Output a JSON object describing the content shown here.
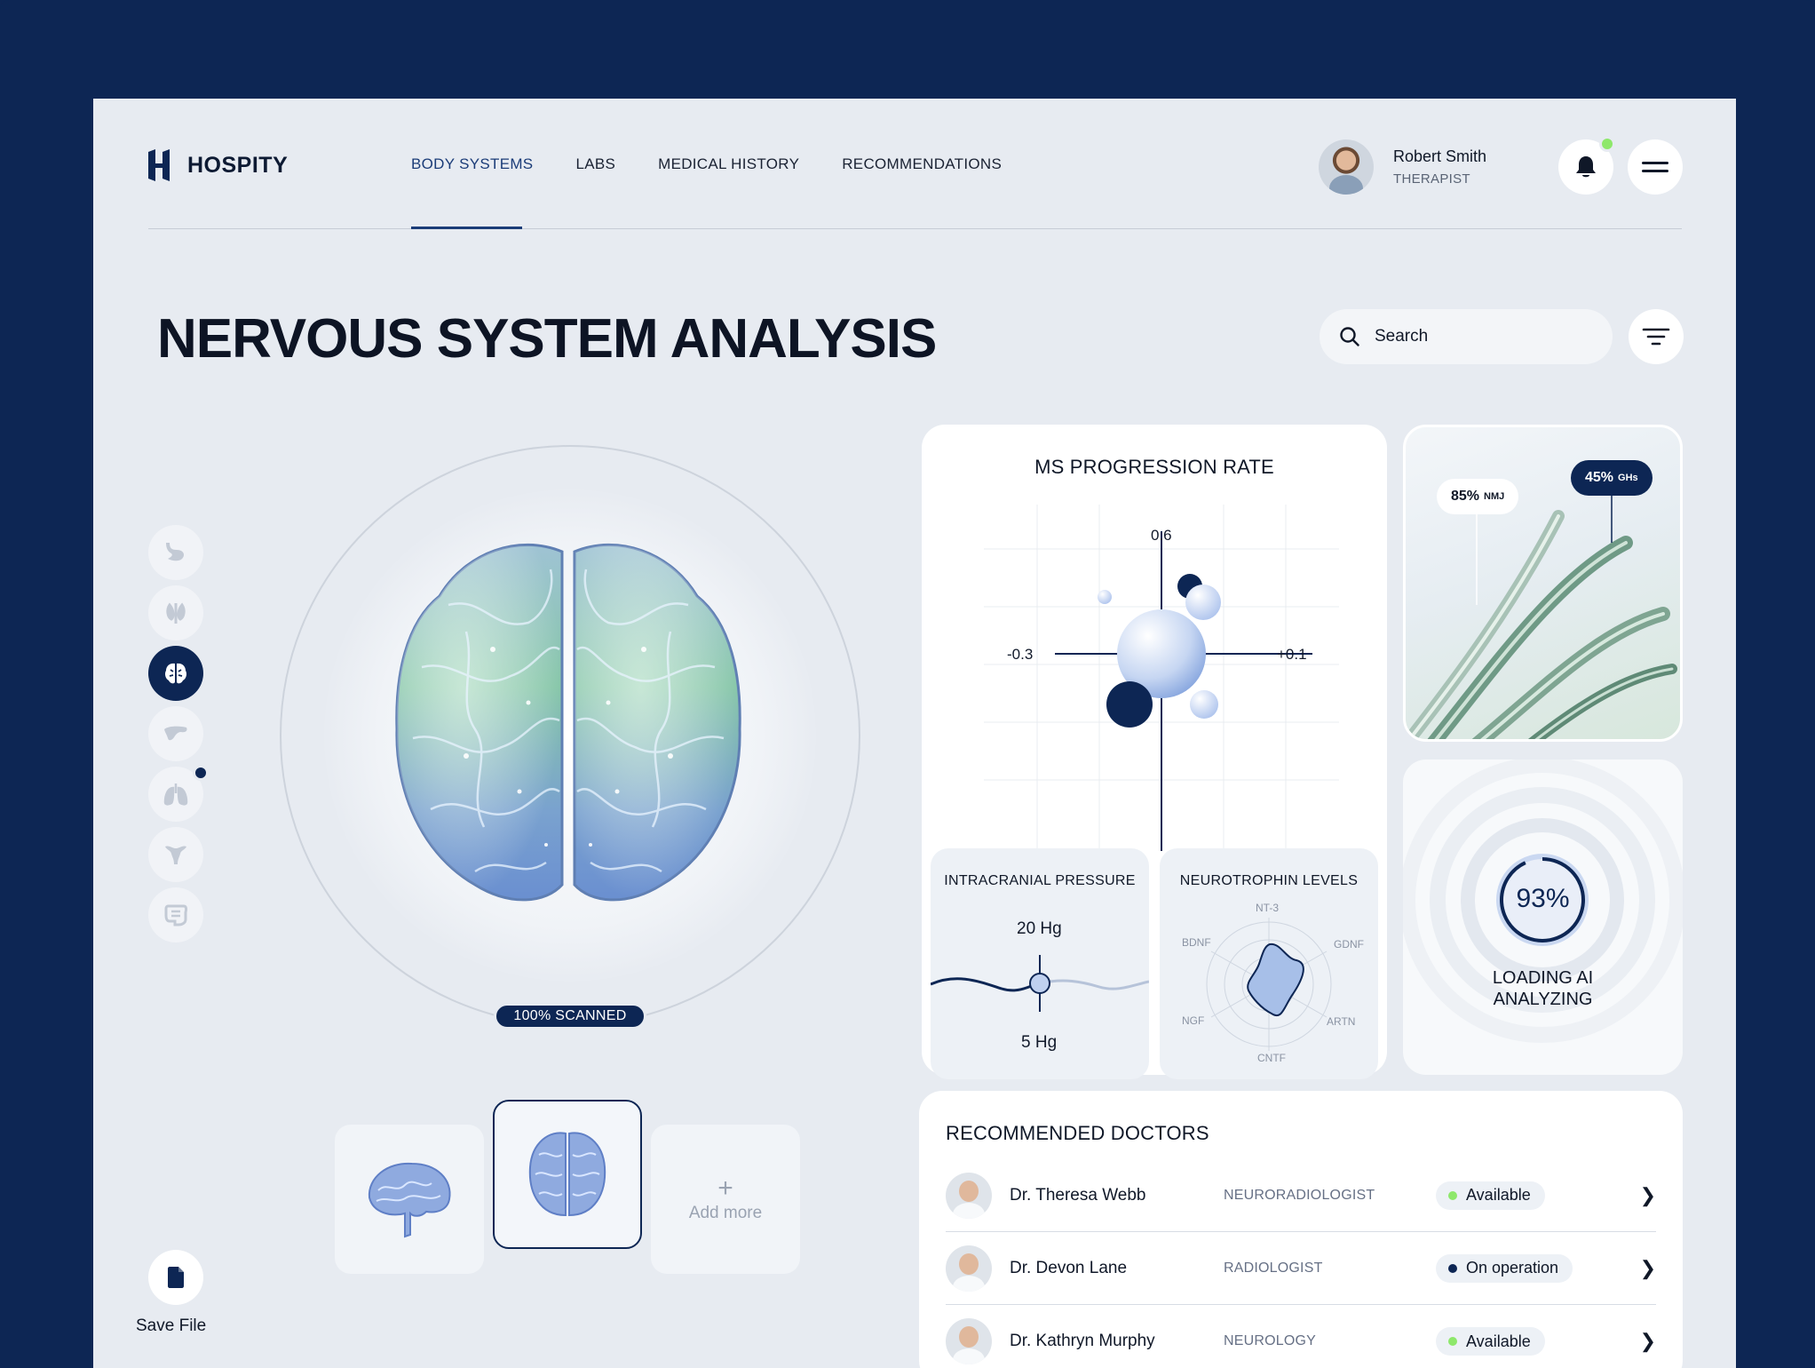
{
  "app": {
    "name": "HOSPITY"
  },
  "nav": {
    "items": [
      {
        "label": "BODY SYSTEMS",
        "active": true
      },
      {
        "label": "LABS"
      },
      {
        "label": "MEDICAL HISTORY"
      },
      {
        "label": "RECOMMENDATIONS"
      }
    ]
  },
  "user": {
    "name": "Robert Smith",
    "role": "THERAPIST"
  },
  "page": {
    "title": "NERVOUS SYSTEM ANALYSIS"
  },
  "search": {
    "placeholder": "Search"
  },
  "rail": {
    "items": [
      {
        "icon": "stomach-icon"
      },
      {
        "icon": "thyroid-icon"
      },
      {
        "icon": "brain-icon",
        "active": true
      },
      {
        "icon": "pancreas-icon"
      },
      {
        "icon": "lungs-icon",
        "badge": true
      },
      {
        "icon": "uterus-icon"
      },
      {
        "icon": "intestine-icon"
      }
    ],
    "save_label": "Save File"
  },
  "scan": {
    "status": "100% SCANNED",
    "add_more": "Add more"
  },
  "progression": {
    "title": "MS PROGRESSION RATE",
    "axis_top": "0.6",
    "axis_left": "-0.3",
    "axis_right": "+0.1"
  },
  "pressure": {
    "title": "INTRACRANIAL PRESSURE",
    "high": "20 Hg",
    "low": "5 Hg"
  },
  "neurotrophin": {
    "title": "NEUROTROPHIN LEVELS",
    "labels": [
      "NT-3",
      "GDNF",
      "ARTN",
      "CNTF",
      "NGF",
      "BDNF"
    ]
  },
  "markers": {
    "left": {
      "value": "85%",
      "unit": "NMJ"
    },
    "right": {
      "value": "45%",
      "unit": "GHs"
    }
  },
  "ai": {
    "percent": "93%",
    "line1": "LOADING AI",
    "line2": "ANALYZING",
    "progress": 0.93
  },
  "doctors": {
    "title": "RECOMMENDED DOCTORS",
    "rows": [
      {
        "name": "Dr. Theresa Webb",
        "specialty": "NEURORADIOLOGIST",
        "status": "Available",
        "status_color": "#8ee86b"
      },
      {
        "name": "Dr. Devon Lane",
        "specialty": "RADIOLOGIST",
        "status": "On operation",
        "status_color": "#0d2654"
      },
      {
        "name": "Dr. Kathryn Murphy",
        "specialty": "NEUROLOGY",
        "status": "Available",
        "status_color": "#8ee86b"
      }
    ]
  },
  "colors": {
    "navy": "#0d2654",
    "accent_green": "#8ee86b",
    "panel": "#e7ebf1"
  }
}
